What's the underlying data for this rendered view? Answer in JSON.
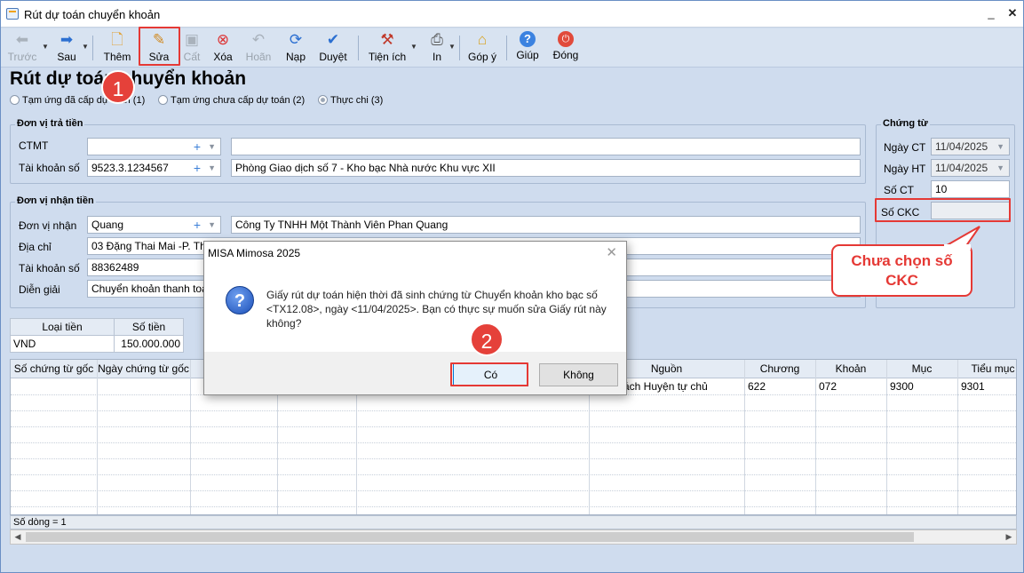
{
  "window": {
    "title": "Rút dự toán chuyển khoản",
    "minimize": "_",
    "close": "✕"
  },
  "toolbar": {
    "prev": "Trước",
    "next": "Sau",
    "add": "Thêm",
    "edit": "Sửa",
    "save": "Cất",
    "delete": "Xóa",
    "undo": "Hoãn",
    "reload": "Nạp",
    "approve": "Duyệt",
    "utilities": "Tiện ích",
    "print": "In",
    "feedback": "Góp ý",
    "help": "Giúp",
    "close": "Đóng"
  },
  "page": {
    "title": "Rút dự toán chuyển khoản",
    "radios": [
      "Tạm ứng đã cấp dự toán (1)",
      "Tạm ứng chưa cấp dự toán (2)",
      "Thực chi (3)"
    ]
  },
  "payer": {
    "group_title": "Đơn vị trả tiền",
    "ctmt_label": "CTMT",
    "ctmt_value": "",
    "ctmt_desc": "",
    "account_label": "Tài khoản số",
    "account_value": "9523.3.1234567",
    "account_desc": "Phòng Giao dịch số 7 - Kho bạc Nhà nước Khu vực XII"
  },
  "payee": {
    "group_title": "Đơn vị nhận tiền",
    "unit_label": "Đơn vị nhận",
    "unit_value": "Quang",
    "unit_desc": "Công Ty TNHH Một Thành Viên Phan Quang",
    "address_label": "Địa chỉ",
    "address_value": "03 Đặng Thai Mai -P. Tha",
    "account_label": "Tài khoản số",
    "account_value": "88362489",
    "desc_label": "Diễn giải",
    "desc_value": "Chuyển khoản thanh toán"
  },
  "voucher": {
    "group_title": "Chứng từ",
    "date_ct_label": "Ngày CT",
    "date_ct": "11/04/2025",
    "date_ht_label": "Ngày HT",
    "date_ht": "11/04/2025",
    "no_label": "Số CT",
    "no_value": "10",
    "ckc_label": "Số CKC",
    "ckc_value": ""
  },
  "currency_table": {
    "headers": [
      "Loại tiền",
      "Số tiền"
    ],
    "row": [
      "VND",
      "150.000.000"
    ]
  },
  "grid": {
    "headers": [
      "Số chứng từ gốc",
      "Ngày chứng từ gốc",
      "Nguồn",
      "Chương",
      "Khoản",
      "Mục",
      "Tiểu mục"
    ],
    "row": {
      "source": "ách Huyện tự chủ",
      "chapter": "622",
      "item": "072",
      "section": "9300",
      "subsection": "9301"
    },
    "footer": "Số dòng = 1"
  },
  "dialog": {
    "title": "MISA Mimosa 2025",
    "message": "Giấy rút dự toán hiện thời đã sinh chứng từ Chuyển khoản kho bạc số <TX12.08>, ngày <11/04/2025>. Bạn có thực sự muốn sửa Giấy rút này không?",
    "yes": "Có",
    "no": "Không"
  },
  "annotations": {
    "callout": "Chưa chọn số CKC",
    "step1": "1",
    "step2": "2",
    "highlight_color": "#e53935"
  }
}
